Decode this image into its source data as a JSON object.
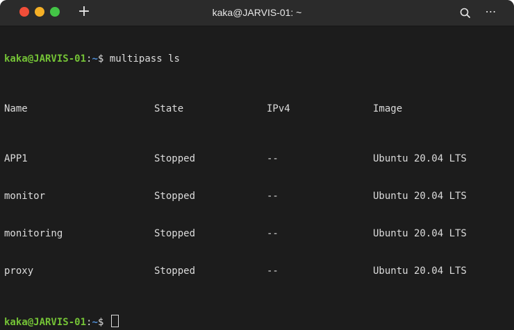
{
  "window": {
    "title": "kaka@JARVIS-01: ~",
    "new_tab_label": "+",
    "menu_label": "⋯"
  },
  "terminal": {
    "command_line": {
      "user_host": "kaka@JARVIS-01",
      "separator": ":",
      "path": "~",
      "prompt_symbol": "$",
      "command": "multipass ls"
    },
    "table": {
      "headers": [
        "Name",
        "State",
        "IPv4",
        "Image"
      ],
      "rows": [
        [
          "APP1",
          "Stopped",
          "--",
          "Ubuntu 20.04 LTS"
        ],
        [
          "monitor",
          "Stopped",
          "--",
          "Ubuntu 20.04 LTS"
        ],
        [
          "monitoring",
          "Stopped",
          "--",
          "Ubuntu 20.04 LTS"
        ],
        [
          "proxy",
          "Stopped",
          "--",
          "Ubuntu 20.04 LTS"
        ]
      ]
    },
    "prompt_line": {
      "user_host": "kaka@JARVIS-01",
      "separator": ":",
      "path": "~",
      "prompt_symbol": "$"
    }
  },
  "colors": {
    "background": "#1c1c1c",
    "titlebar": "#2b2b2b",
    "user_green": "#74c236",
    "path_blue": "#4f8fd8",
    "close": "#f14e39",
    "minimize": "#f5b026",
    "maximize": "#43c446"
  },
  "icons": {
    "close": "close-dot-icon",
    "minimize": "minimize-dot-icon",
    "maximize": "maximize-dot-icon",
    "search": "search-icon",
    "menu": "ellipsis-menu-icon"
  }
}
